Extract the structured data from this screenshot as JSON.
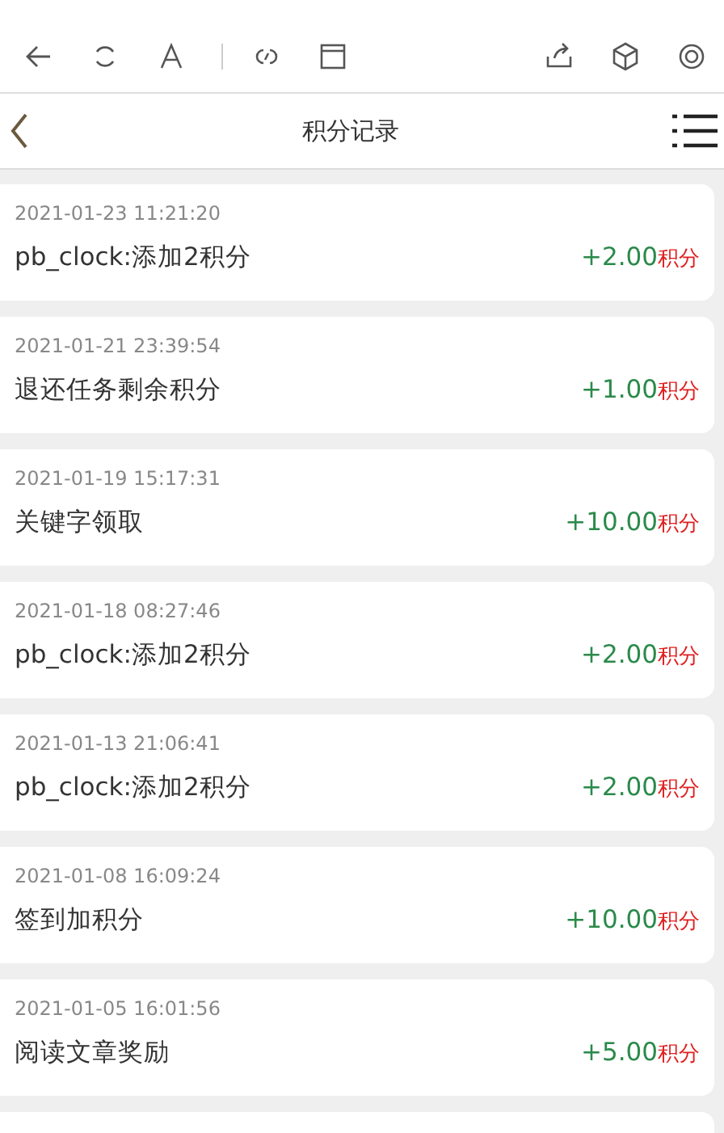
{
  "header": {
    "title": "积分记录"
  },
  "records": [
    {
      "time": "2021-01-23 11:21:20",
      "description": "pb_clock:添加2积分",
      "amount": "+2.00",
      "unit": "积分"
    },
    {
      "time": "2021-01-21 23:39:54",
      "description": "退还任务剩余积分",
      "amount": "+1.00",
      "unit": "积分"
    },
    {
      "time": "2021-01-19 15:17:31",
      "description": "关键字领取",
      "amount": "+10.00",
      "unit": "积分"
    },
    {
      "time": "2021-01-18 08:27:46",
      "description": "pb_clock:添加2积分",
      "amount": "+2.00",
      "unit": "积分"
    },
    {
      "time": "2021-01-13 21:06:41",
      "description": "pb_clock:添加2积分",
      "amount": "+2.00",
      "unit": "积分"
    },
    {
      "time": "2021-01-08 16:09:24",
      "description": "签到加积分",
      "amount": "+10.00",
      "unit": "积分"
    },
    {
      "time": "2021-01-05 16:01:56",
      "description": "阅读文章奖励",
      "amount": "+5.00",
      "unit": "积分"
    }
  ]
}
